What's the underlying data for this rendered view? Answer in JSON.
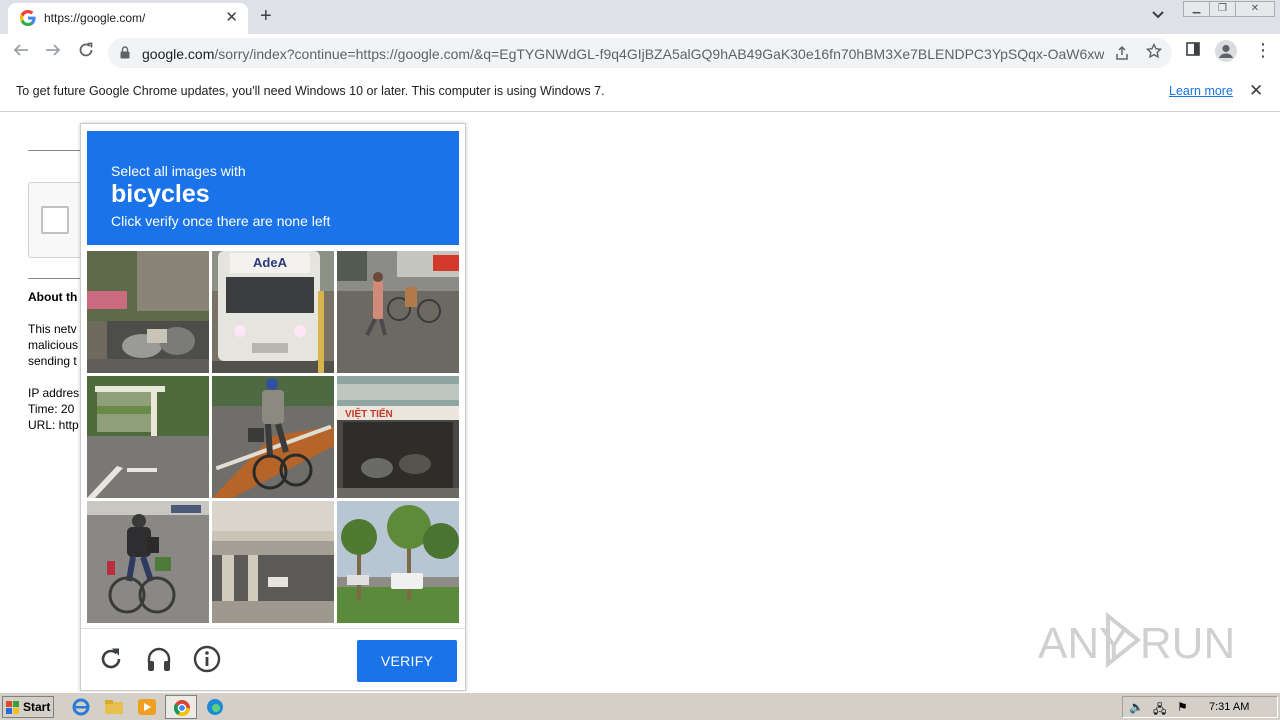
{
  "browser": {
    "tab_title": "https://google.com/",
    "url_host": "google.com",
    "url_rest": "/sorry/index?continue=https://google.com/&q=EgTYGNWdGL-f9q4GIjBZA5alGQ9hAB49GaK30e16fn70hBM3Xe7BLENDPC3YpSQqx-OaW6xwL...",
    "tab_close_glyph": "✕",
    "new_tab_glyph": "+",
    "tab_search_glyph": "⌄",
    "menu_glyph": "⋮"
  },
  "infobar": {
    "message": "To get future Google Chrome updates, you'll need Windows 10 or later. This computer is using Windows 7.",
    "learn_more": "Learn more",
    "close_glyph": "✕"
  },
  "page": {
    "about_heading": "About th",
    "line1": "This netv",
    "line2": "malicious",
    "line3": "sending t",
    "ip_label": "IP addres",
    "time_label": "Time: 20",
    "url_label": "URL: http"
  },
  "captcha": {
    "instruction_line1": "Select all images with",
    "target": "bicycles",
    "instruction_line3": "Click verify once there are none left",
    "verify_label": "VERIFY",
    "header_color": "#1a73e8",
    "tiles": [
      {
        "id": "tile-1"
      },
      {
        "id": "tile-2"
      },
      {
        "id": "tile-3"
      },
      {
        "id": "tile-4"
      },
      {
        "id": "tile-5"
      },
      {
        "id": "tile-6"
      },
      {
        "id": "tile-7"
      },
      {
        "id": "tile-8"
      },
      {
        "id": "tile-9"
      }
    ],
    "tile6_sign": "VIỆT TIẾN",
    "tile2_sign": "AdeA"
  },
  "watermark": {
    "text": "ANY RUN"
  },
  "taskbar": {
    "start_label": "Start",
    "clock": "7:31 AM"
  }
}
